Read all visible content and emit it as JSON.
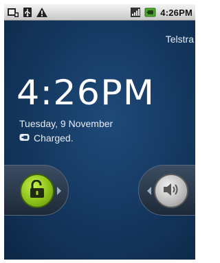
{
  "status_bar": {
    "time": "4:26PM",
    "icons_left": [
      "screenshot-icon",
      "usb-icon",
      "warning-icon"
    ],
    "icons_right": [
      "signal-strength-icon",
      "battery-charging-icon"
    ]
  },
  "lock_screen": {
    "carrier": "Telstra",
    "clock": "4:26PM",
    "date": "Tuesday, 9 November",
    "battery_status": "Charged."
  },
  "slider": {
    "left_action": "unlock",
    "right_action": "sound"
  },
  "colors": {
    "background": "#163a63",
    "unlock_knob": "#8cc11a",
    "status_bar": "#d9d9d9"
  }
}
